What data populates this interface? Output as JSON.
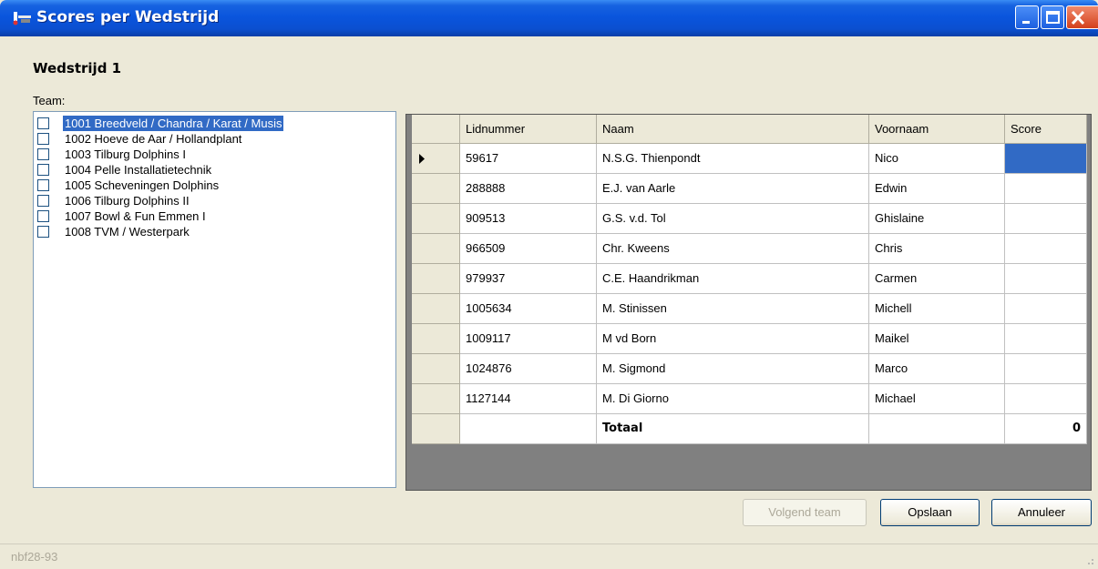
{
  "window": {
    "title": "Scores per Wedstrijd"
  },
  "heading": "Wedstrijd 1",
  "team_label": "Team:",
  "teams": [
    {
      "label": "1001 Breedveld / Chandra / Karat / Musis",
      "selected": true
    },
    {
      "label": "1002 Hoeve de Aar / Hollandplant"
    },
    {
      "label": "1003 Tilburg Dolphins I"
    },
    {
      "label": "1004 Pelle Installatietechnik"
    },
    {
      "label": "1005 Scheveningen Dolphins"
    },
    {
      "label": "1006 Tilburg Dolphins II"
    },
    {
      "label": "1007 Bowl & Fun Emmen I"
    },
    {
      "label": "1008 TVM / Westerpark"
    }
  ],
  "grid": {
    "columns": [
      "Lidnummer",
      "Naam",
      "Voornaam",
      "Score"
    ],
    "rows": [
      [
        "59617",
        "N.S.G. Thienpondt",
        "Nico",
        ""
      ],
      [
        "288888",
        "E.J. van Aarle",
        "Edwin",
        ""
      ],
      [
        "909513",
        "G.S. v.d. Tol",
        "Ghislaine",
        ""
      ],
      [
        "966509",
        "Chr. Kweens",
        "Chris",
        ""
      ],
      [
        "979937",
        "C.E. Haandrikman",
        "Carmen",
        ""
      ],
      [
        "1005634",
        "M. Stinissen",
        "Michell",
        ""
      ],
      [
        "1009117",
        "M vd Born",
        "Maikel",
        ""
      ],
      [
        "1024876",
        "M. Sigmond",
        "Marco",
        ""
      ],
      [
        "1127144",
        "M. Di Giorno",
        "Michael",
        ""
      ]
    ],
    "total_label": "Totaal",
    "total_value": "0"
  },
  "buttons": {
    "next_team": "Volgend team",
    "save": "Opslaan",
    "cancel": "Annuleer"
  },
  "status": "nbf28-93",
  "colors": {
    "selection": "#316ac5",
    "titlebar": "#0a55dd"
  }
}
